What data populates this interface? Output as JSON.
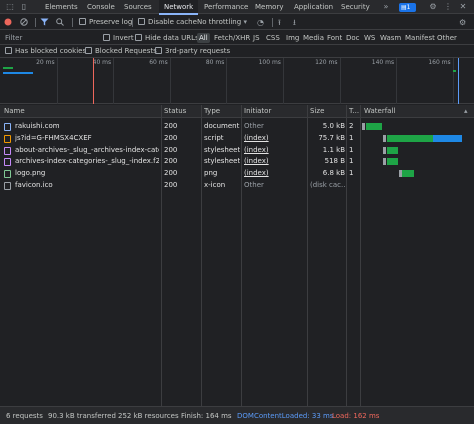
{
  "tabs": {
    "items": [
      "Elements",
      "Console",
      "Sources",
      "Network",
      "Performance",
      "Memory",
      "Application",
      "Security"
    ],
    "active": "Network",
    "more": "»",
    "issues_count": "1"
  },
  "toolbar": {
    "preserve_log": "Preserve log",
    "disable_cache": "Disable cache",
    "throttling": "No throttling"
  },
  "filter": {
    "placeholder": "Filter",
    "invert": "Invert",
    "hide_data_urls": "Hide data URLs",
    "types": [
      "All",
      "Fetch/XHR",
      "JS",
      "CSS",
      "Img",
      "Media",
      "Font",
      "Doc",
      "WS",
      "Wasm",
      "Manifest",
      "Other"
    ],
    "active_type": "All",
    "has_blocked_cookies": "Has blocked cookies",
    "blocked_requests": "Blocked Requests",
    "third_party": "3rd-party requests"
  },
  "timeline": {
    "ticks": [
      "20 ms",
      "40 ms",
      "60 ms",
      "80 ms",
      "100 ms",
      "120 ms",
      "140 ms",
      "160 ms"
    ],
    "domcontentloaded_ms": 33,
    "load_ms": 162
  },
  "table": {
    "headers": [
      "Name",
      "Status",
      "Type",
      "Initiator",
      "Size",
      "T...",
      "Waterfall"
    ],
    "rows": [
      {
        "name": "rakuishi.com",
        "status": "200",
        "type": "document",
        "initiator": "Other",
        "size": "5.0 kB",
        "time": "2",
        "icon": "document-icon",
        "color": "#8ab4f8"
      },
      {
        "name": "js?id=G-FHMSX4CXEF",
        "status": "200",
        "type": "script",
        "initiator": "(index)",
        "size": "75.7 kB",
        "time": "1",
        "icon": "script-icon",
        "color": "#f29900"
      },
      {
        "name": "about-archives-_slug_-archives-index-categ...",
        "status": "200",
        "type": "stylesheet",
        "initiator": "(index)",
        "size": "1.1 kB",
        "time": "1",
        "icon": "stylesheet-icon",
        "color": "#c58af9"
      },
      {
        "name": "archives-index-categories-_slug_-index.f231f...",
        "status": "200",
        "type": "stylesheet",
        "initiator": "(index)",
        "size": "518 B",
        "time": "1",
        "icon": "stylesheet-icon",
        "color": "#c58af9"
      },
      {
        "name": "logo.png",
        "status": "200",
        "type": "png",
        "initiator": "(index)",
        "size": "6.8 kB",
        "time": "1",
        "icon": "image-icon",
        "color": "#81c995"
      },
      {
        "name": "favicon.ico",
        "status": "200",
        "type": "x-icon",
        "initiator": "Other",
        "size": "(disk cac...",
        "time": "",
        "icon": "file-icon",
        "color": "#9aa0a6"
      }
    ]
  },
  "status": {
    "requests": "6 requests",
    "transferred": "90.3 kB transferred",
    "resources": "252 kB resources",
    "finish": "Finish: 164 ms",
    "dcl": "DOMContentLoaded: 33 ms",
    "load": "Load: 162 ms"
  },
  "colors": {
    "accent": "#8ab4f8",
    "dcl": "#5b9bf8",
    "load": "#ee675c",
    "bar_wait": "#1ea446",
    "bar_download": "#1e88e5"
  }
}
